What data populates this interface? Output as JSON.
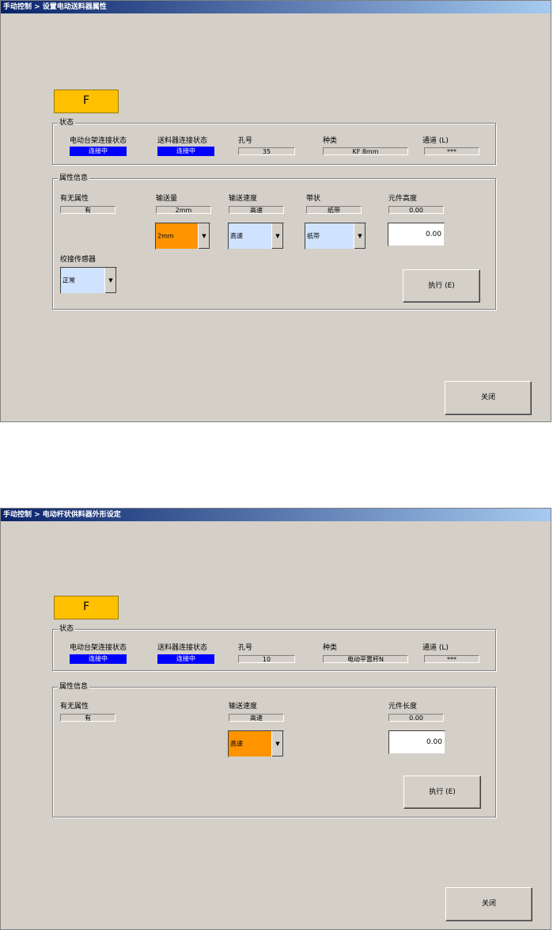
{
  "window1": {
    "title": "手动控制 > 设置电动送料器属性",
    "badge": "F",
    "status": {
      "legend": "状态",
      "rack_label": "电动台架连接状态",
      "rack_value": "连接中",
      "feeder_label": "送料器连接状态",
      "feeder_value": "连接中",
      "hole_label": "孔号",
      "hole_value": "35",
      "kind_label": "种类",
      "kind_value": "KF 8mm",
      "channel_label": "通道 (L)",
      "channel_value": "***"
    },
    "attr": {
      "legend": "属性信息",
      "presence_label": "有无属性",
      "presence_value": "有",
      "feed_amount_label": "输送量",
      "feed_amount_value": "2mm",
      "feed_amount_select": "2mm",
      "feed_speed_label": "输送速度",
      "feed_speed_value": "高速",
      "feed_speed_select": "高速",
      "tape_label": "带状",
      "tape_value": "纸带",
      "tape_select": "纸带",
      "height_label": "元件高度",
      "height_value": "0.00",
      "height_input": "0.00",
      "splice_label": "绞接传感器",
      "splice_select": "正常",
      "execute": "执行 (E)"
    },
    "close": "关闭"
  },
  "window2": {
    "title": "手动控制 > 电动杆状供料器外形设定",
    "badge": "F",
    "status": {
      "legend": "状态",
      "rack_label": "电动台架连接状态",
      "rack_value": "连接中",
      "feeder_label": "送料器连接状态",
      "feeder_value": "连接中",
      "hole_label": "孔号",
      "hole_value": "10",
      "kind_label": "种类",
      "kind_value": "电动平置杆N",
      "channel_label": "通道 (L)",
      "channel_value": "***"
    },
    "attr": {
      "legend": "属性信息",
      "presence_label": "有无属性",
      "presence_value": "有",
      "feed_speed_label": "输送速度",
      "feed_speed_value": "高速",
      "feed_speed_select": "高速",
      "length_label": "元件长度",
      "length_value": "0.00",
      "length_input": "0.00",
      "execute": "执行 (E)"
    },
    "close": "关闭"
  },
  "colors": {
    "window_bg": "#d4d0c8",
    "title_start": "#0a246a",
    "title_end": "#a6caf0",
    "badge": "#ffc000",
    "connected": "#0000ff",
    "combo_active": "#ff9400",
    "combo_normal": "#cfe3ff"
  },
  "icons": {
    "dropdown": "chevron-down-icon"
  }
}
